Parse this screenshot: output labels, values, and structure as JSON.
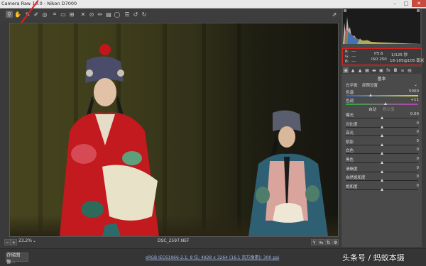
{
  "window": {
    "title": "Camera Raw 10.0  -  Nikon D7000",
    "min": "–",
    "max": "□",
    "close": "✕"
  },
  "toolbar": {
    "tools": [
      "zoom-icon",
      "hand-icon",
      "white-balance-icon",
      "color-sampler-icon",
      "targeted-adjust-icon",
      "crop-icon",
      "straighten-icon",
      "transform-icon",
      "spot-removal-icon",
      "red-eye-icon",
      "adjustment-brush-icon",
      "graduated-filter-icon",
      "radial-filter-icon",
      "preferences-icon",
      "rotate-ccw-icon",
      "rotate-cw-icon"
    ],
    "open_icon": "open-image-icon"
  },
  "preview": {
    "zoom": "23.2%",
    "filename": "DSC_2597.NEF"
  },
  "exif": {
    "r": "R:",
    "g": "G:",
    "b": "B:",
    "r_val": "---",
    "g_val": "---",
    "b_val": "---",
    "aperture": "f/5.6",
    "shutter": "1/125 秒",
    "iso": "ISO 250",
    "focal": "18-105@105 毫米"
  },
  "panel": {
    "section_title": "基本",
    "white_balance_label": "白平衡:",
    "white_balance_value": "原照设置",
    "controls": [
      {
        "label": "色温",
        "value": "5000",
        "pos": 0.35
      },
      {
        "label": "色调",
        "value": "+11",
        "pos": 0.55
      }
    ],
    "auto": "自动",
    "default": "默认值",
    "sliders": [
      {
        "label": "曝光",
        "value": "0.00",
        "pos": 0.5
      },
      {
        "label": "对比度",
        "value": "0",
        "pos": 0.5
      },
      {
        "label": "高光",
        "value": "0",
        "pos": 0.5
      },
      {
        "label": "阴影",
        "value": "0",
        "pos": 0.5
      },
      {
        "label": "白色",
        "value": "0",
        "pos": 0.5
      },
      {
        "label": "黑色",
        "value": "0",
        "pos": 0.5
      },
      {
        "label": "清晰度",
        "value": "0",
        "pos": 0.5
      },
      {
        "label": "自然饱和度",
        "value": "0",
        "pos": 0.5
      },
      {
        "label": "饱和度",
        "value": "0",
        "pos": 0.5
      }
    ]
  },
  "footer": {
    "save_button": "存储图像...",
    "workflow_link": "sRGB IEC61966-2.1; 8 位; 4928 x 3264 (16.1 百万像素); 300 ppi",
    "watermark": "头条号 / 蚂蚁本摄"
  },
  "colors": {
    "accent": "#e02020"
  }
}
